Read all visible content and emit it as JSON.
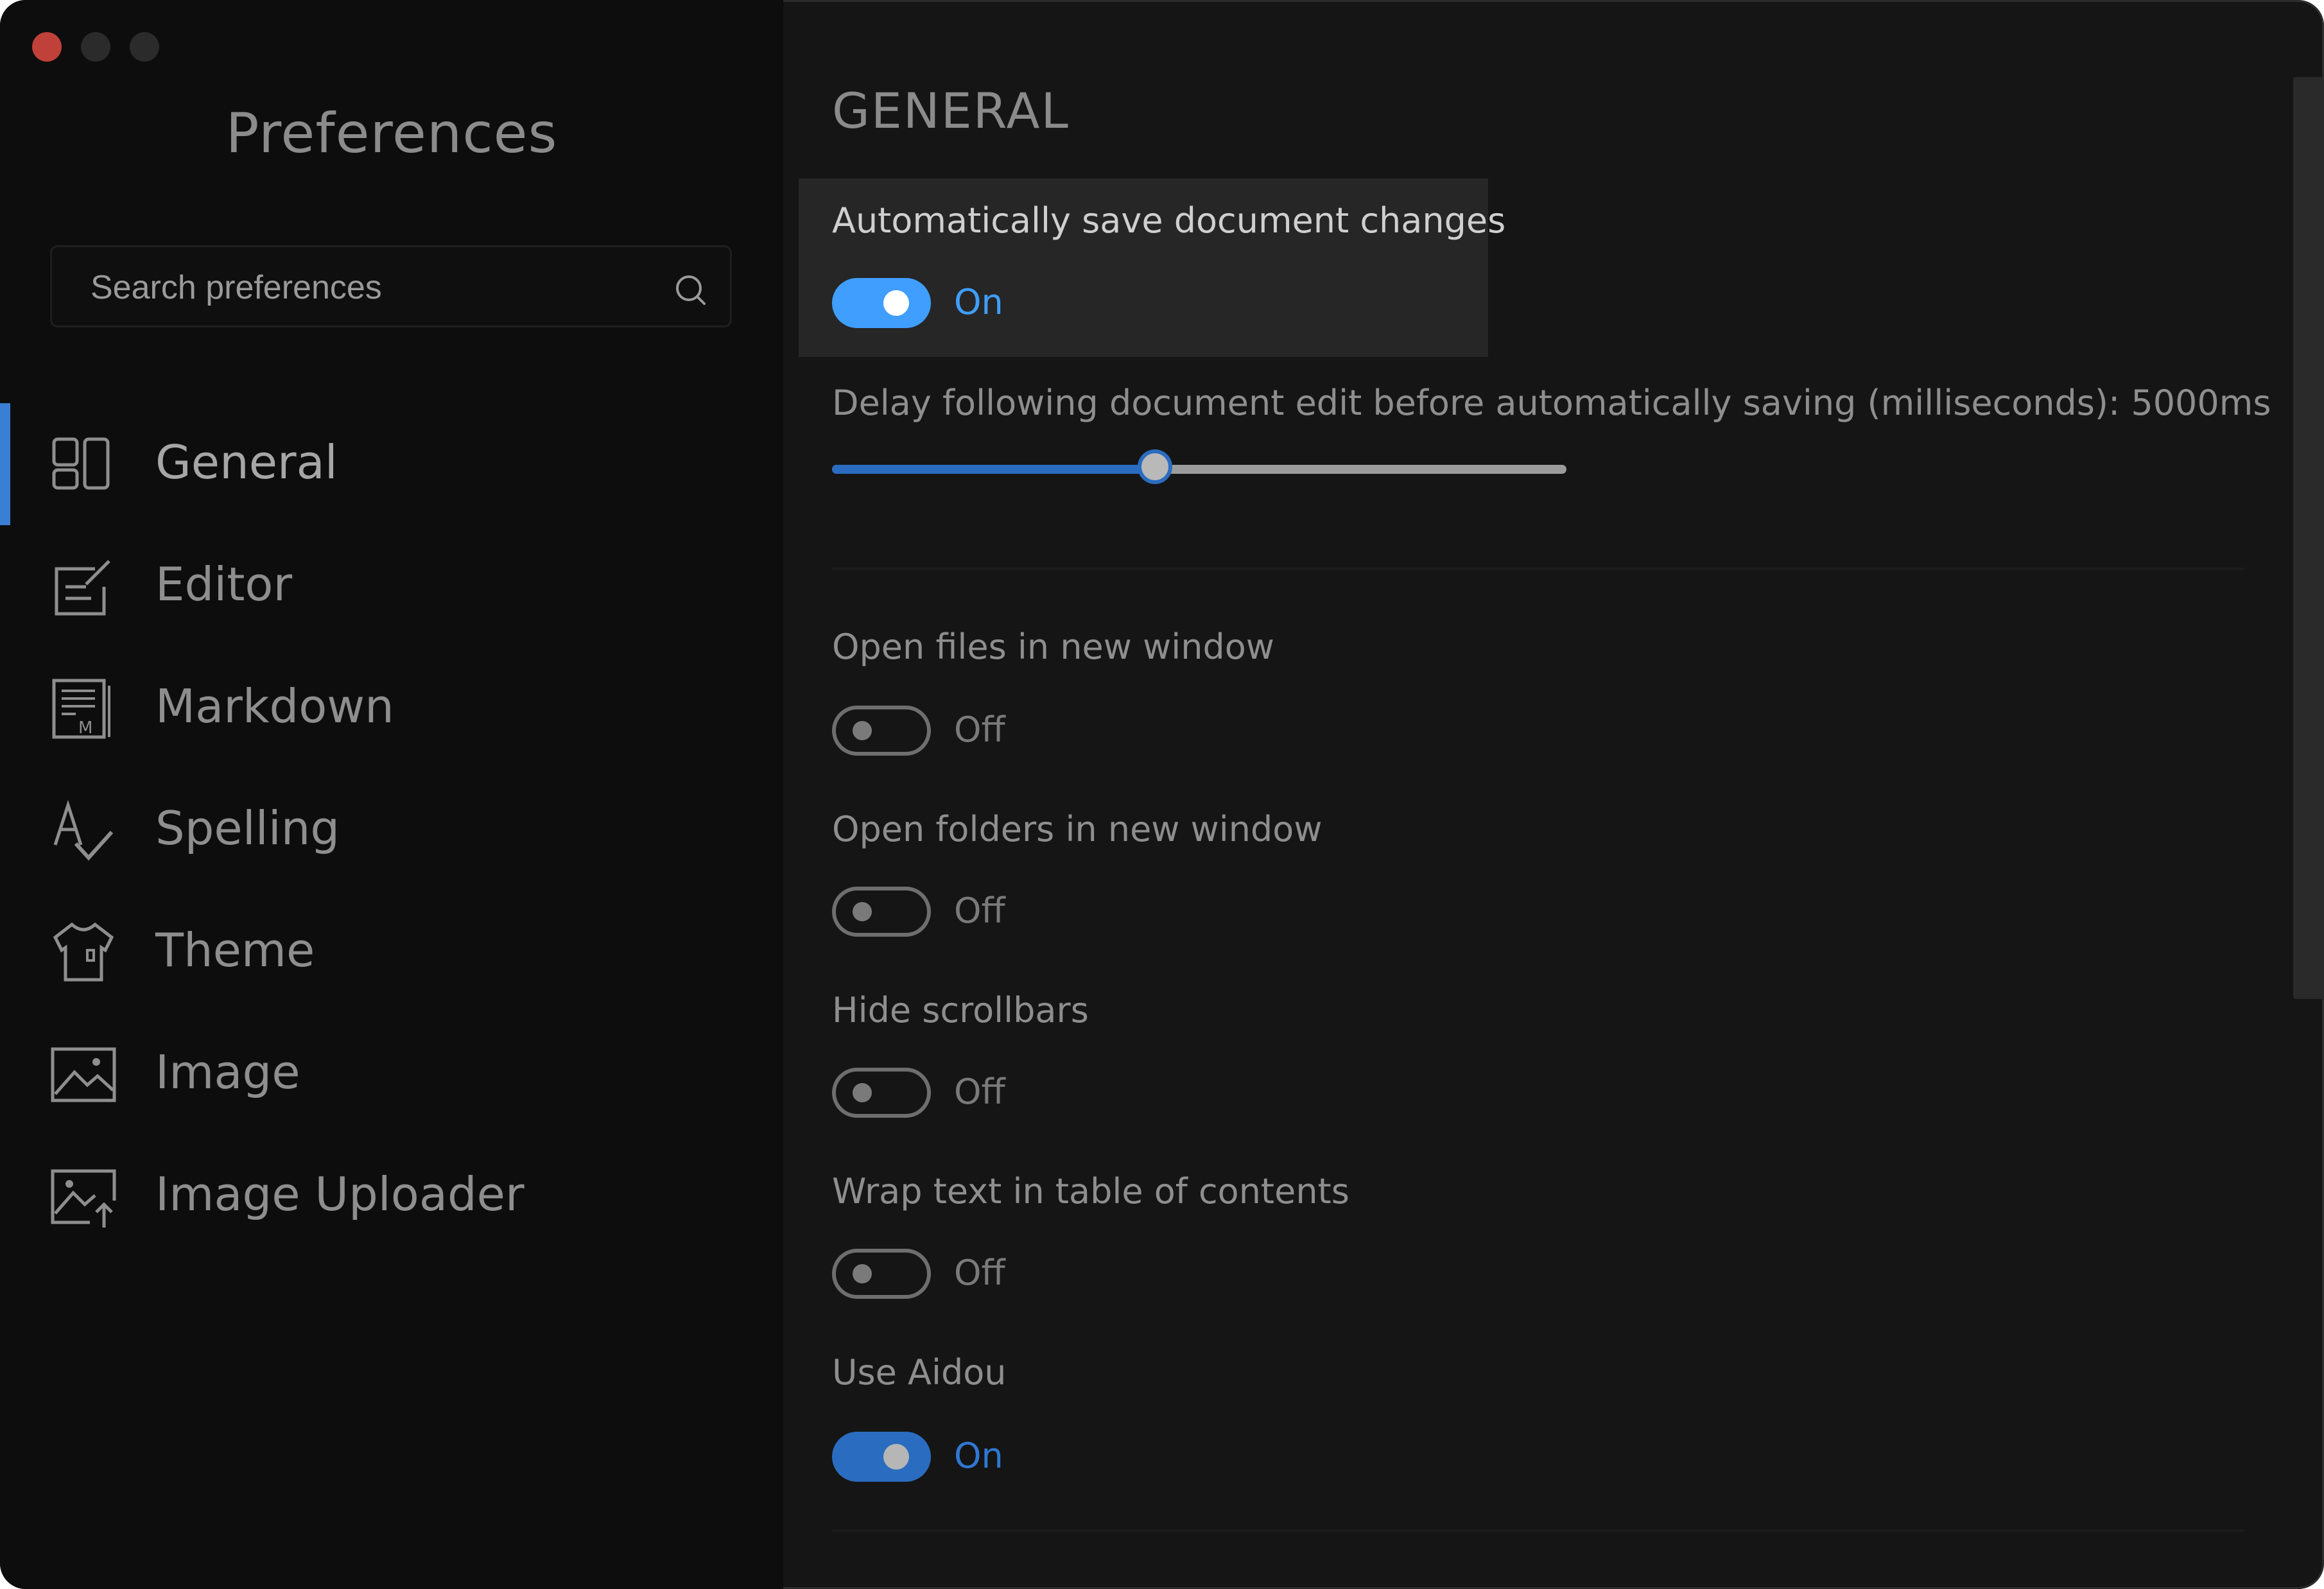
{
  "window": {
    "traffic_lights": {
      "close": "#c0413a",
      "minimize": "#2b2b2b",
      "maximize": "#2b2b2b"
    }
  },
  "sidebar": {
    "title": "Preferences",
    "search": {
      "placeholder": "Search preferences",
      "icon": "search-icon"
    },
    "active_index": 0,
    "accent": "#3a7fd3",
    "items": [
      {
        "label": "General",
        "icon": "general-icon"
      },
      {
        "label": "Editor",
        "icon": "editor-icon"
      },
      {
        "label": "Markdown",
        "icon": "markdown-icon"
      },
      {
        "label": "Spelling",
        "icon": "spelling-icon"
      },
      {
        "label": "Theme",
        "icon": "theme-icon"
      },
      {
        "label": "Image",
        "icon": "image-icon"
      },
      {
        "label": "Image Uploader",
        "icon": "image-uploader-icon"
      }
    ]
  },
  "main": {
    "section_title": "GENERAL",
    "autosave": {
      "label": "Automatically save document changes",
      "state": "On",
      "enabled": true
    },
    "autosave_delay": {
      "label": "Delay following document edit before automatically saving (milliseconds): 5000ms",
      "value_fraction": 0.44
    },
    "settings": [
      {
        "label": "Open files in new window",
        "state": "Off",
        "enabled": false
      },
      {
        "label": "Open folders in new window",
        "state": "Off",
        "enabled": false
      },
      {
        "label": "Hide scrollbars",
        "state": "Off",
        "enabled": false
      },
      {
        "label": "Wrap text in table of contents",
        "state": "Off",
        "enabled": false
      },
      {
        "label": "Use Aidou",
        "state": "On",
        "enabled": true
      }
    ]
  },
  "colors": {
    "toggle_on": "#409eff",
    "toggle_on_dim": "#2a6cc0",
    "background": "#151515",
    "sidebar": "#0d0d0d"
  }
}
